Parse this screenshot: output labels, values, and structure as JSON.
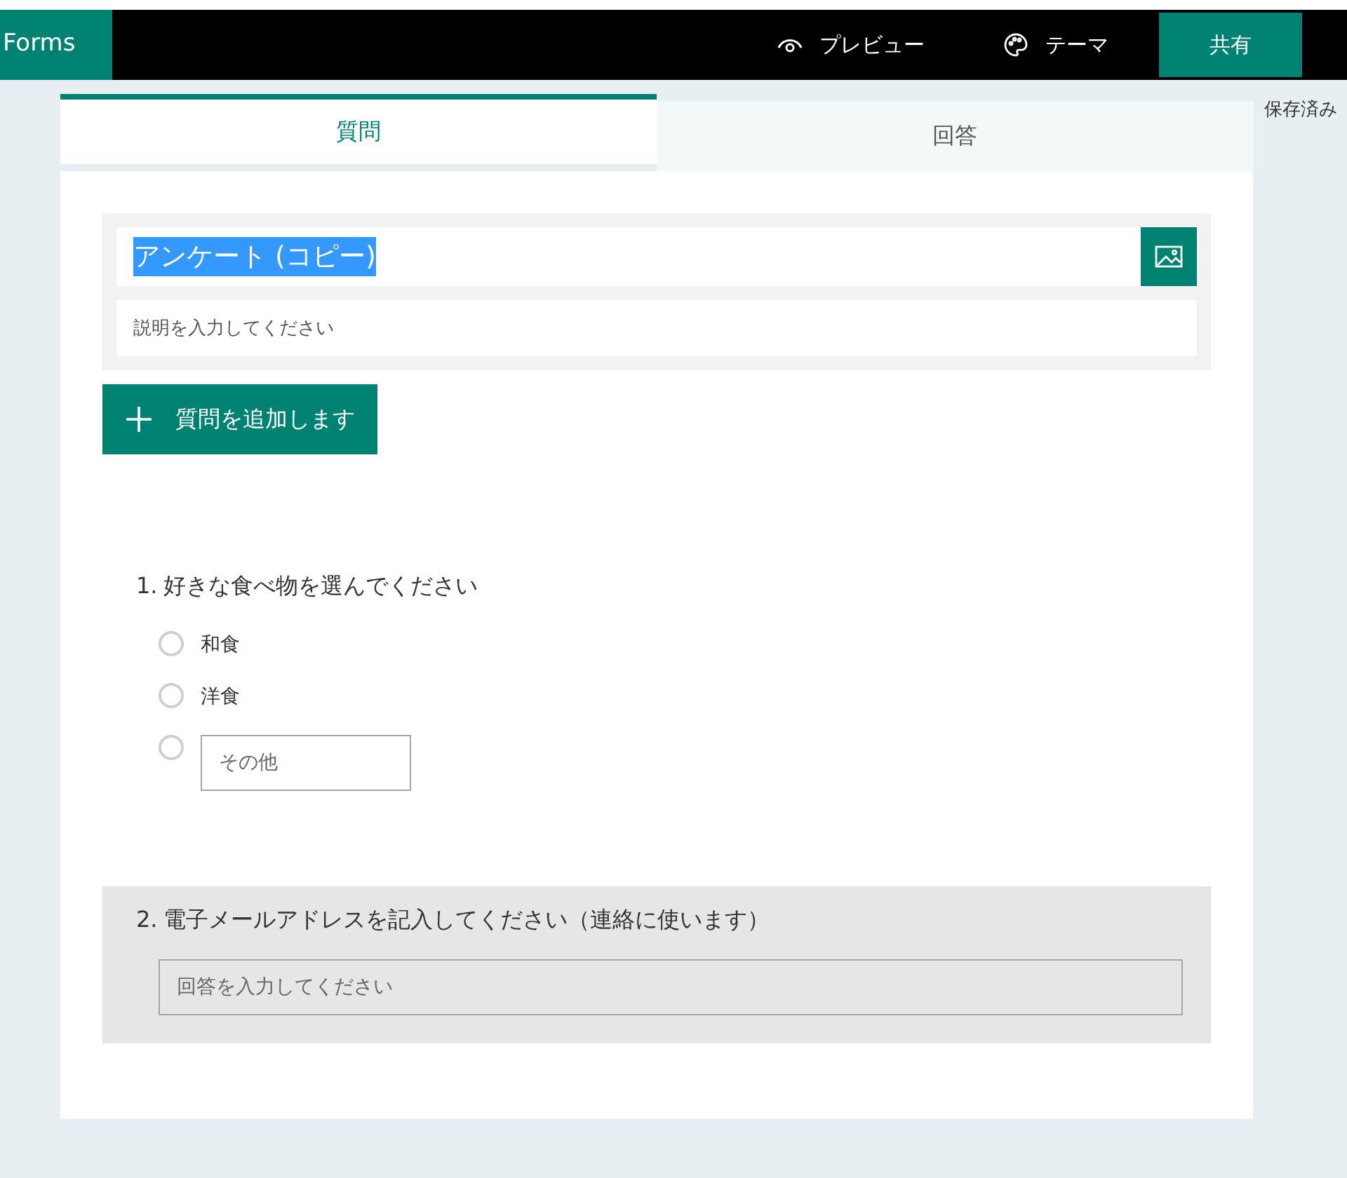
{
  "header": {
    "app_name": "Forms",
    "actions": [
      {
        "kind": "preview",
        "label": "プレビュー"
      },
      {
        "kind": "theme",
        "label": "テーマ"
      }
    ],
    "share_button": "共有"
  },
  "save_status": "保存済み",
  "tabs": [
    {
      "label": "質問",
      "selected": true
    },
    {
      "label": "回答",
      "selected": false
    }
  ],
  "form": {
    "title": "アンケート (コピー)",
    "title_text_selected": true,
    "description_placeholder": "説明を入力してください"
  },
  "add_question_button": "質問を追加します",
  "questions": [
    {
      "kind": "choice",
      "number": "1.",
      "text": "好きな食べ物を選んでください",
      "selected": false,
      "options": [
        {
          "kind": "option",
          "label": "和食",
          "selected": false
        },
        {
          "kind": "option",
          "label": "洋食",
          "selected": false
        },
        {
          "kind": "other",
          "placeholder": "その他",
          "selected": false
        }
      ]
    },
    {
      "kind": "text",
      "number": "2.",
      "text": "電子メールアドレスを記入してください（連絡に使います）",
      "selected": true,
      "placeholder": "回答を入力してください"
    }
  ]
}
